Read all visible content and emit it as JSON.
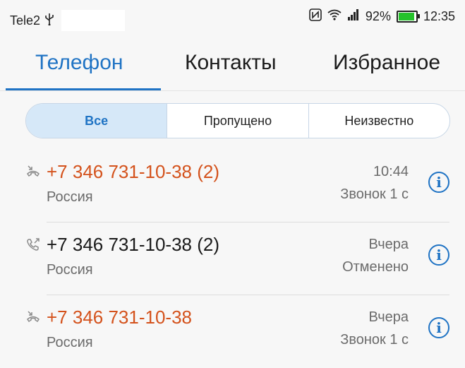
{
  "status_bar": {
    "carrier": "Tele2",
    "usb_icon": "usb-icon",
    "nfc_icon": "nfc-icon",
    "wifi_icon": "wifi-icon",
    "signal_icon": "signal-icon",
    "battery_percent": "92%",
    "time": "12:35"
  },
  "tabs": [
    {
      "label": "Телефон",
      "active": true
    },
    {
      "label": "Контакты",
      "active": false
    },
    {
      "label": "Избранное",
      "active": false
    }
  ],
  "filter": {
    "options": [
      "Все",
      "Пропущено",
      "Неизвестно"
    ],
    "selected": "Все"
  },
  "calls": [
    {
      "icon": "missed-call-icon",
      "number": "+7 346 731-10-38",
      "count": "(2)",
      "missed": true,
      "region": "Россия",
      "time": "10:44",
      "detail": "Звонок 1 с"
    },
    {
      "icon": "outgoing-call-icon",
      "number": "+7 346 731-10-38",
      "count": "(2)",
      "missed": false,
      "region": "Россия",
      "time": "Вчера",
      "detail": "Отменено"
    },
    {
      "icon": "missed-call-icon",
      "number": "+7 346 731-10-38",
      "count": "",
      "missed": true,
      "region": "Россия",
      "time": "Вчера",
      "detail": "Звонок 1 с"
    }
  ],
  "colors": {
    "accent": "#1f73c4",
    "missed": "#d4521c",
    "battery": "#25c22b"
  }
}
